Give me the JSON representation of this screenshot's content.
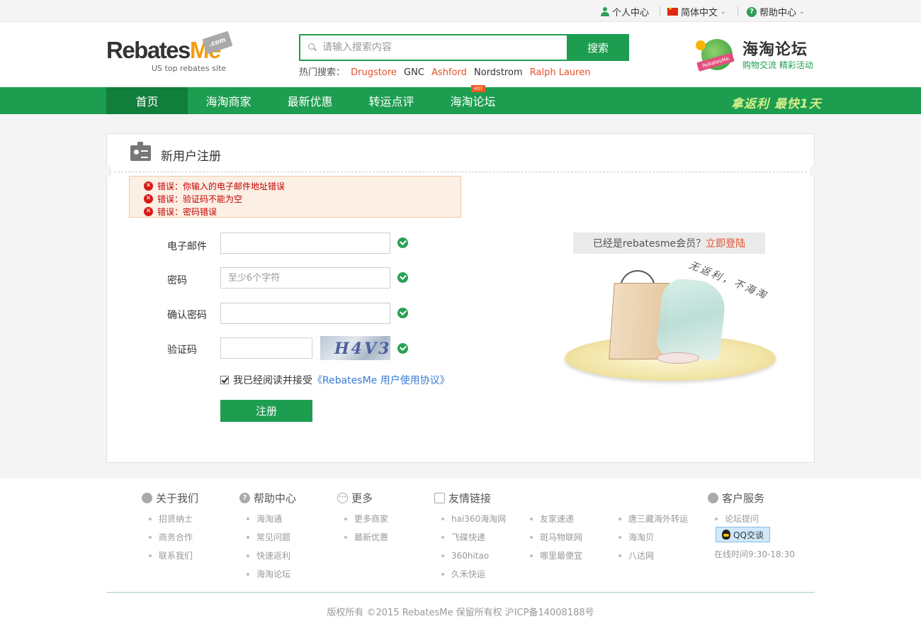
{
  "topbar": {
    "personal_center": "个人中心",
    "language": "简体中文",
    "help_center": "帮助中心"
  },
  "header": {
    "logo_main_a": "Rebates",
    "logo_main_b": "Me",
    "logo_dotcom": ".com",
    "logo_sub": "US top rebates site",
    "search_placeholder": "请输入搜索内容",
    "search_button": "搜索",
    "hot_label": "热门搜索：",
    "hot_terms": [
      "Drugstore",
      "GNC",
      "Ashford",
      "Nordstrom",
      "Ralph Lauren"
    ],
    "forum_ribbon": "RebatesMe",
    "forum_title": "海淘论坛",
    "forum_sub": "购物交流  精彩活动"
  },
  "nav": {
    "items": [
      "首页",
      "海淘商家",
      "最新优惠",
      "转运点评",
      "海淘论坛"
    ],
    "hot_tag": "HOT",
    "slogan": "拿返利 最快1天"
  },
  "panel": {
    "title": "新用户注册",
    "errors": [
      "错误：你输入的电子邮件地址错误",
      "错误：验证码不能为空",
      "错误：密码错误"
    ],
    "labels": {
      "email": "电子邮件",
      "password": "密码",
      "confirm": "确认密码",
      "captcha": "验证码"
    },
    "password_placeholder": "至少6个字符",
    "captcha_text": "H4V3",
    "agree_text": "我已经阅读并接受",
    "agree_link": "《RebatesMe 用户使用协议》",
    "register_button": "注册",
    "member_prompt": "已经是rebatesme会员？",
    "login_link": "立即登陆",
    "handwriting": "无返利，不海淘"
  },
  "footer": {
    "about": {
      "title": "关于我们",
      "items": [
        "招贤纳士",
        "商务合作",
        "联系我们"
      ]
    },
    "help": {
      "title": "帮助中心",
      "items": [
        "海淘通",
        "常见问题",
        "快速返利",
        "海淘论坛"
      ]
    },
    "more": {
      "title": "更多",
      "items": [
        "更多商家",
        "最新优惠"
      ]
    },
    "links": {
      "title": "友情链接",
      "col1": [
        "hai360海淘网",
        "飞碟快递",
        "360hitao",
        "久禾快运"
      ],
      "col2": [
        "友家速递",
        "斑马物联网",
        "哪里最便宜"
      ],
      "col3": [
        "唐三藏海外转运",
        "海淘贝",
        "八达网"
      ]
    },
    "service": {
      "title": "客户服务",
      "items": [
        "论坛提问"
      ],
      "qq": "QQ交谈",
      "hours": "在线时间9:30-18:30"
    },
    "copyright": "版权所有 ©2015 RebatesMe 保留所有权 沪ICP备14008188号"
  },
  "colors": {
    "brand_green": "#1d9d50",
    "accent_orange": "#e4502c",
    "error_red": "#c40000"
  }
}
